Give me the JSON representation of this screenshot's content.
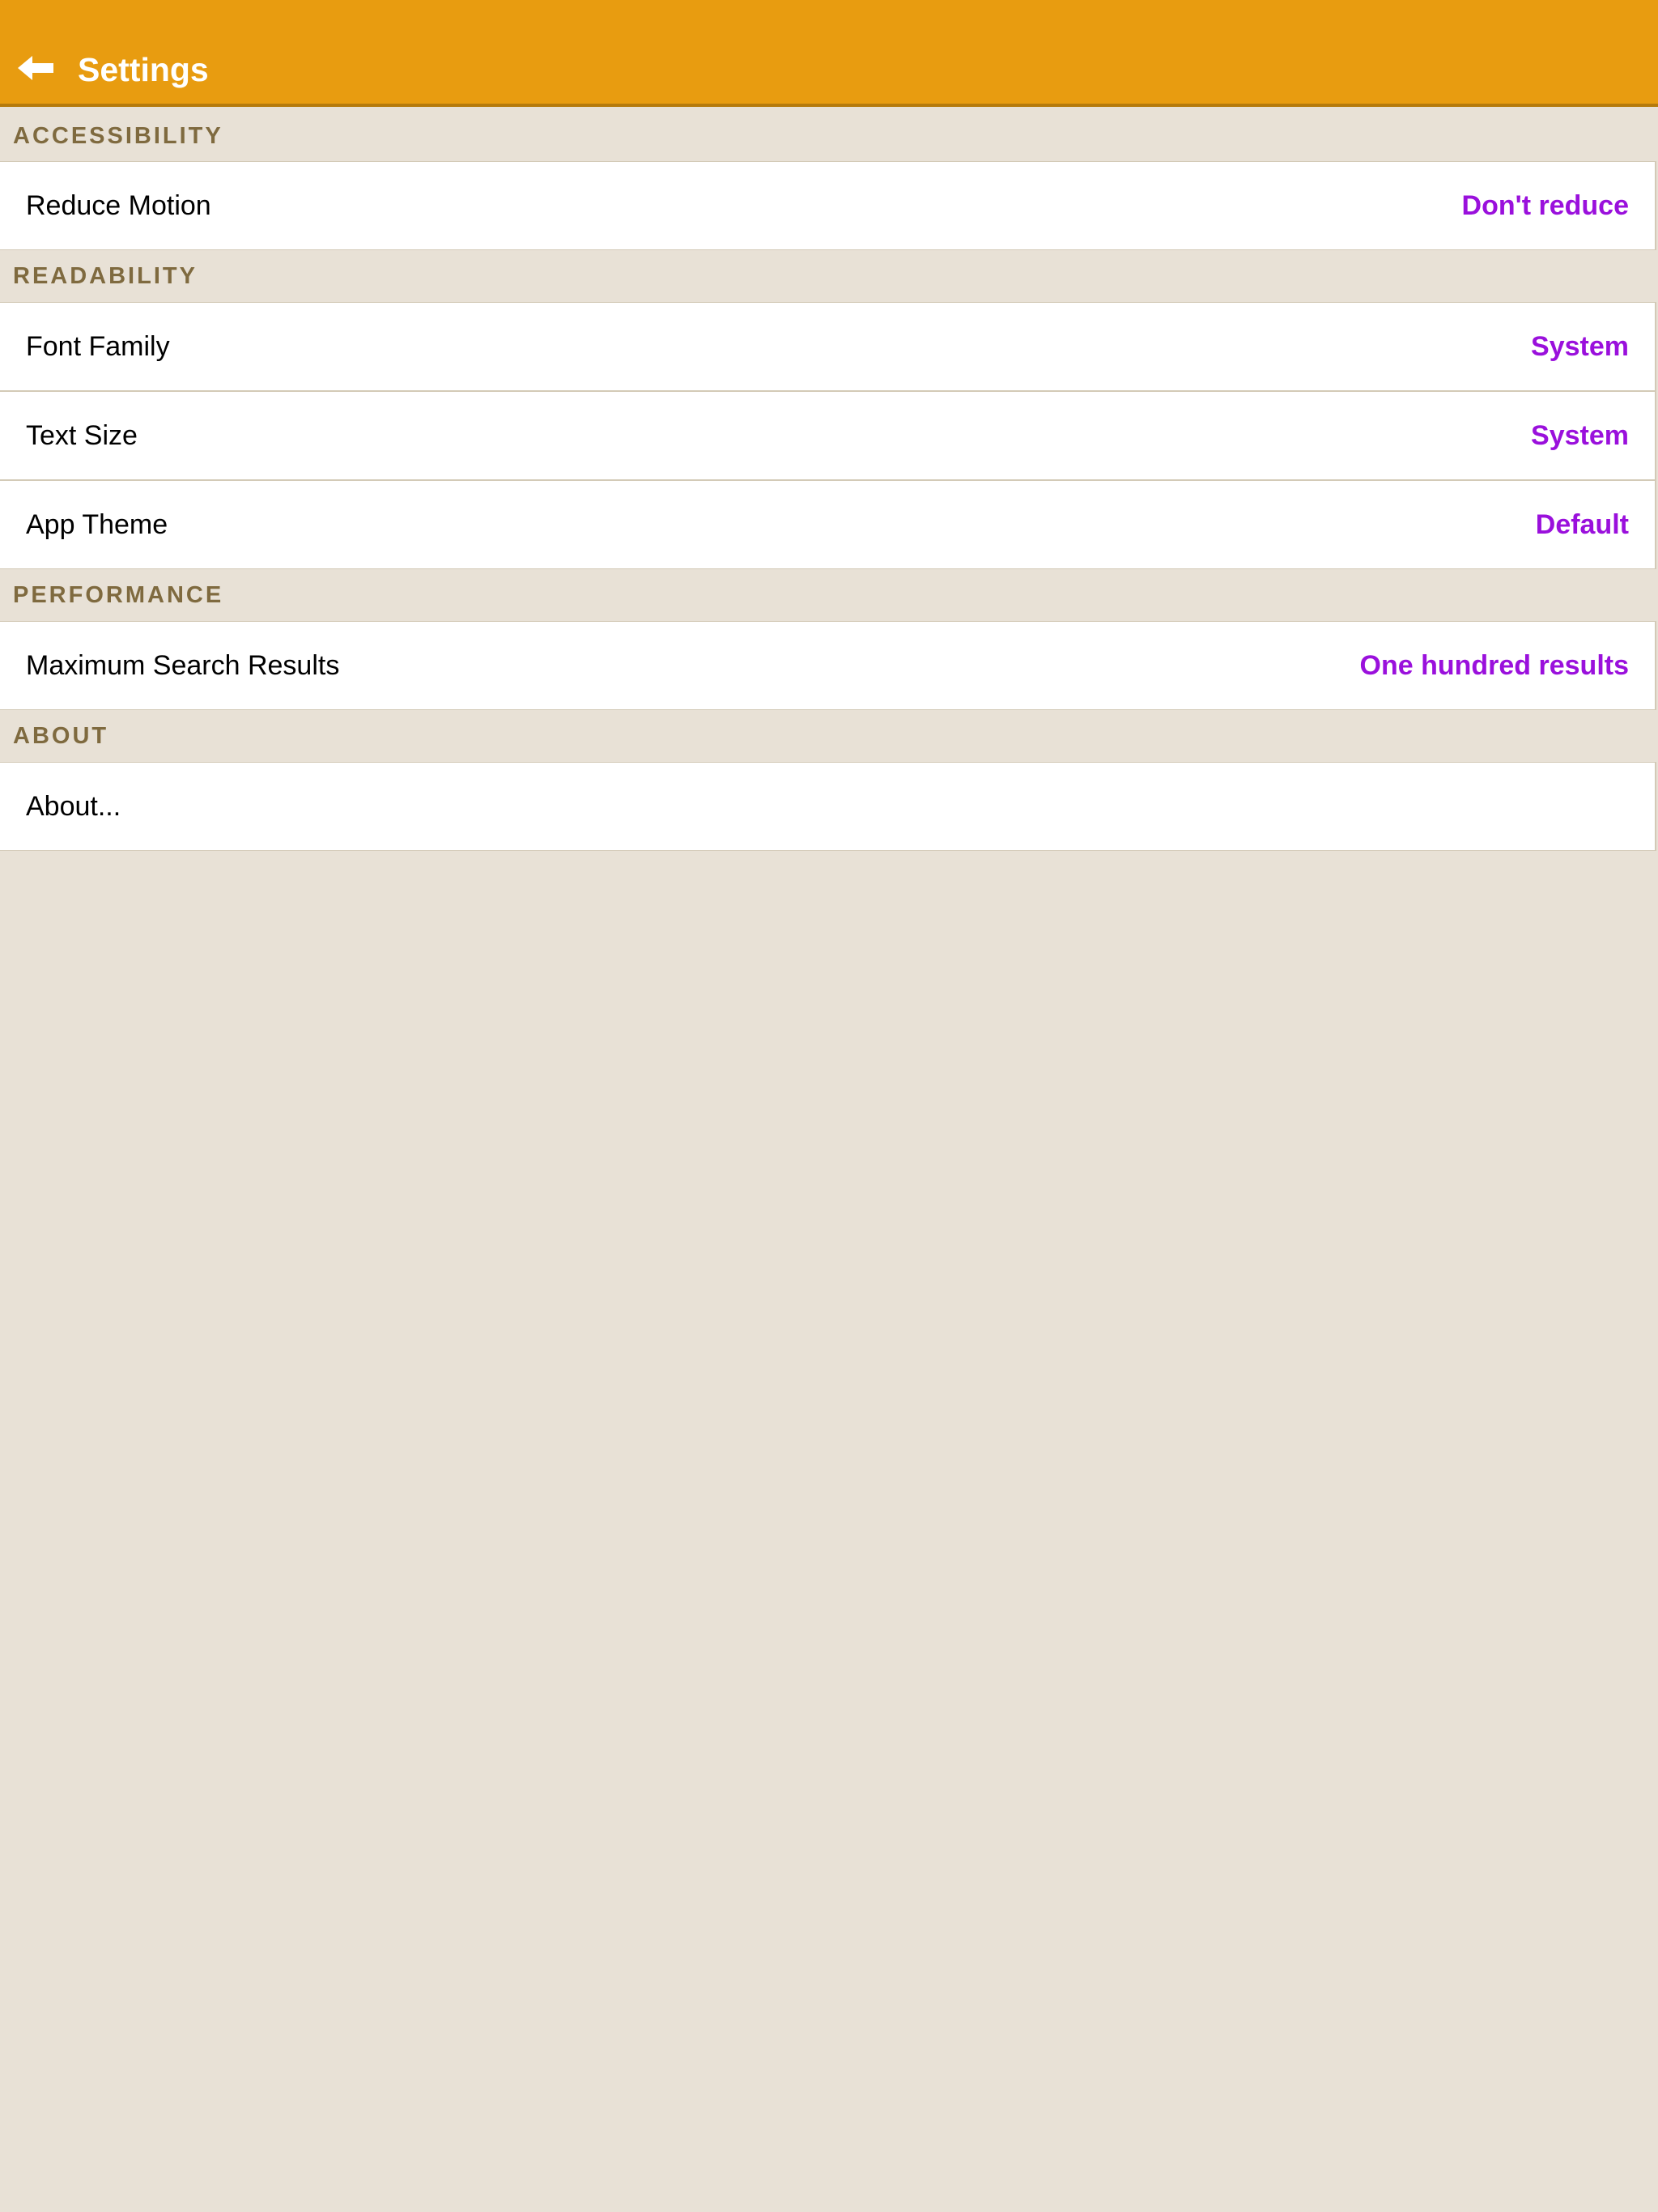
{
  "header": {
    "title": "Settings",
    "back_icon": "back-arrow-icon",
    "background_color": "#e89c10"
  },
  "sections": [
    {
      "title": "ACCESSIBILITY",
      "items": [
        {
          "label": "Reduce Motion",
          "value": "Don't reduce"
        }
      ]
    },
    {
      "title": "READABILITY",
      "items": [
        {
          "label": "Font Family",
          "value": "System"
        },
        {
          "label": "Text Size",
          "value": "System"
        },
        {
          "label": "App Theme",
          "value": "Default"
        }
      ]
    },
    {
      "title": "PERFORMANCE",
      "items": [
        {
          "label": "Maximum Search Results",
          "value": "One hundred results"
        }
      ]
    },
    {
      "title": "ABOUT",
      "items": [
        {
          "label": "About...",
          "value": ""
        }
      ]
    }
  ],
  "colors": {
    "section_header_text": "#7f6a3f",
    "value_text": "#9a10dc",
    "page_background": "#e8e1d6"
  }
}
